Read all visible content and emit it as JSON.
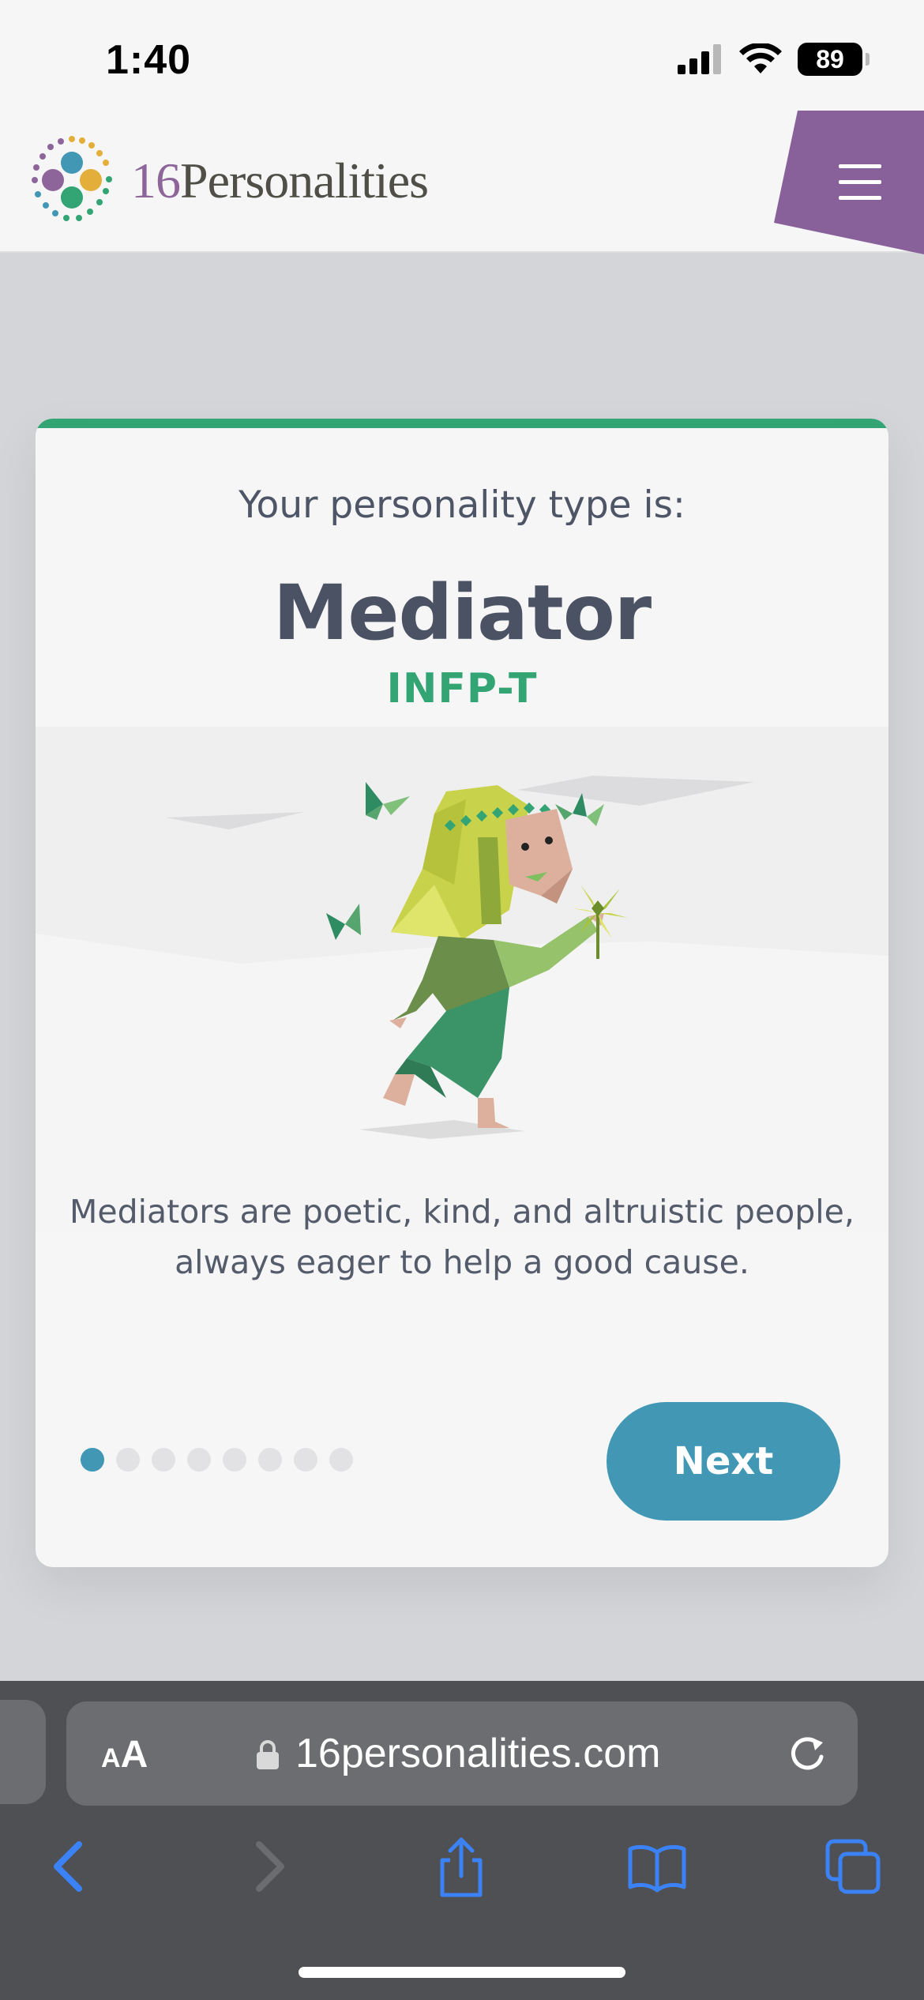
{
  "status_bar": {
    "time": "1:40",
    "battery": "89",
    "icons": [
      "cellular-signal-icon",
      "wifi-icon",
      "battery-icon"
    ]
  },
  "header": {
    "brand_number": "16",
    "brand_word": "Personalities",
    "menu_icon": "hamburger-menu-icon",
    "colors": {
      "brand_purple": "#8e659a",
      "brand_text": "#4f4f48"
    }
  },
  "card": {
    "intro": "Your personality type is:",
    "type_name": "Mediator",
    "type_code": "INFP-T",
    "description": "Mediators are poetic, kind, and altruistic people, always eager to help a good cause.",
    "pagination": {
      "total": 8,
      "current": 1
    },
    "next_label": "Next",
    "colors": {
      "accent_green": "#33a474",
      "button_blue": "#4298b4"
    }
  },
  "browser": {
    "text_size_small": "A",
    "text_size_big": "A",
    "url": "16personalities.com",
    "icons": [
      "lock-icon",
      "reload-icon",
      "back-icon",
      "forward-icon",
      "share-icon",
      "bookmarks-icon",
      "tabs-icon"
    ]
  }
}
